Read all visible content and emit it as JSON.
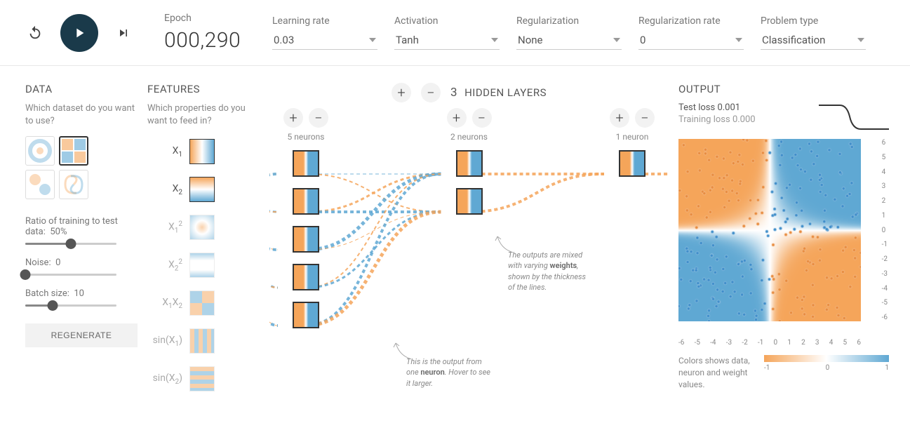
{
  "controls": {
    "reset_icon": "reset",
    "play_icon": "play",
    "step_icon": "step",
    "epoch_label": "Epoch",
    "epoch_value": "000,290",
    "params": [
      {
        "label": "Learning rate",
        "value": "0.03"
      },
      {
        "label": "Activation",
        "value": "Tanh"
      },
      {
        "label": "Regularization",
        "value": "None"
      },
      {
        "label": "Regularization rate",
        "value": "0"
      },
      {
        "label": "Problem type",
        "value": "Classification"
      }
    ]
  },
  "data_panel": {
    "title": "DATA",
    "subtitle": "Which dataset do you want to use?",
    "datasets": [
      "circle",
      "xor",
      "gauss",
      "spiral"
    ],
    "selected_dataset": 1,
    "ratio_label": "Ratio of training to test data:",
    "ratio_value": "50%",
    "ratio_pct": 50,
    "noise_label": "Noise:",
    "noise_value": "0",
    "noise_pct": 0,
    "batch_label": "Batch size:",
    "batch_value": "10",
    "batch_pct": 30,
    "regenerate": "REGENERATE"
  },
  "features_panel": {
    "title": "FEATURES",
    "subtitle": "Which properties do you want to feed in?",
    "items": [
      {
        "label_html": "X<sub>1</sub>",
        "active": true,
        "cls": "f-x1"
      },
      {
        "label_html": "X<sub>2</sub>",
        "active": true,
        "cls": "f-x2"
      },
      {
        "label_html": "X<sub>1</sub><sup>2</sup>",
        "active": false,
        "cls": "f-x1sq"
      },
      {
        "label_html": "X<sub>2</sub><sup>2</sup>",
        "active": false,
        "cls": "f-x2sq"
      },
      {
        "label_html": "X<sub>1</sub>X<sub>2</sub>",
        "active": false,
        "cls": "f-x1x2"
      },
      {
        "label_html": "sin(X<sub>1</sub>)",
        "active": false,
        "cls": "f-sinx1"
      },
      {
        "label_html": "sin(X<sub>2</sub>)",
        "active": false,
        "cls": "f-sinx2"
      }
    ]
  },
  "network": {
    "add": "+",
    "sub": "−",
    "count": "3",
    "title": "HIDDEN LAYERS",
    "layers": [
      {
        "neurons": 5,
        "label": "5 neurons"
      },
      {
        "neurons": 2,
        "label": "2 neurons"
      },
      {
        "neurons": 1,
        "label": "1 neuron"
      }
    ],
    "callout_weights": "The outputs are mixed with varying <b>weights</b>, shown by the thickness of the lines.",
    "callout_neuron": "This is the output from one <b>neuron</b>. Hover to see it larger."
  },
  "output": {
    "title": "OUTPUT",
    "test_loss_label": "Test loss",
    "test_loss_value": "0.001",
    "training_loss_label": "Training loss",
    "training_loss_value": "0.000",
    "axis_ticks": [
      "-6",
      "-5",
      "-4",
      "-3",
      "-2",
      "-1",
      "0",
      "1",
      "2",
      "3",
      "4",
      "5",
      "6"
    ],
    "axis_ticks_y": [
      "6",
      "5",
      "4",
      "3",
      "2",
      "1",
      "0",
      "-1",
      "-2",
      "-3",
      "-4",
      "-5",
      "-6"
    ],
    "colorbar_text": "Colors shows data, neuron and weight values.",
    "colorbar_ticks": [
      "-1",
      "0",
      "1"
    ]
  },
  "colors": {
    "orange": "#f5a55a",
    "blue": "#5fa8d3",
    "dark": "#1a3a4a"
  }
}
